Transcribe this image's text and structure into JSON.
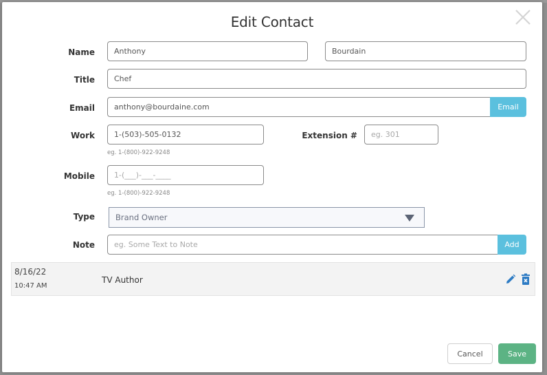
{
  "modal": {
    "title": "Edit Contact",
    "close_icon": "close-x-icon"
  },
  "form": {
    "name": {
      "label": "Name",
      "first_value": "Anthony",
      "last_value": "Bourdain"
    },
    "title": {
      "label": "Title",
      "value": "Chef"
    },
    "email": {
      "label": "Email",
      "value": "anthony@bourdaine.com",
      "button_label": "Email"
    },
    "work": {
      "label": "Work",
      "value": "1-(503)-505-0132",
      "hint": "eg. 1-(800)-922-9248"
    },
    "extension": {
      "label": "Extension #",
      "value": "",
      "placeholder": "eg. 301"
    },
    "mobile": {
      "label": "Mobile",
      "value": "",
      "placeholder": "1-(___)-___-____",
      "hint": "eg. 1-(800)-922-9248"
    },
    "type": {
      "label": "Type",
      "selected": "Brand Owner"
    },
    "note": {
      "label": "Note",
      "value": "",
      "placeholder": "eg. Some Text to Note",
      "button_label": "Add"
    }
  },
  "notes": [
    {
      "date": "8/16/22",
      "time": "10:47 AM",
      "text": "TV Author",
      "edit_icon": "pencil-icon",
      "delete_icon": "trash-icon"
    }
  ],
  "footer": {
    "cancel_label": "Cancel",
    "save_label": "Save"
  },
  "colors": {
    "info_button": "#5bc0de",
    "save_button": "#5cb384",
    "action_icon": "#2d7bc4"
  }
}
